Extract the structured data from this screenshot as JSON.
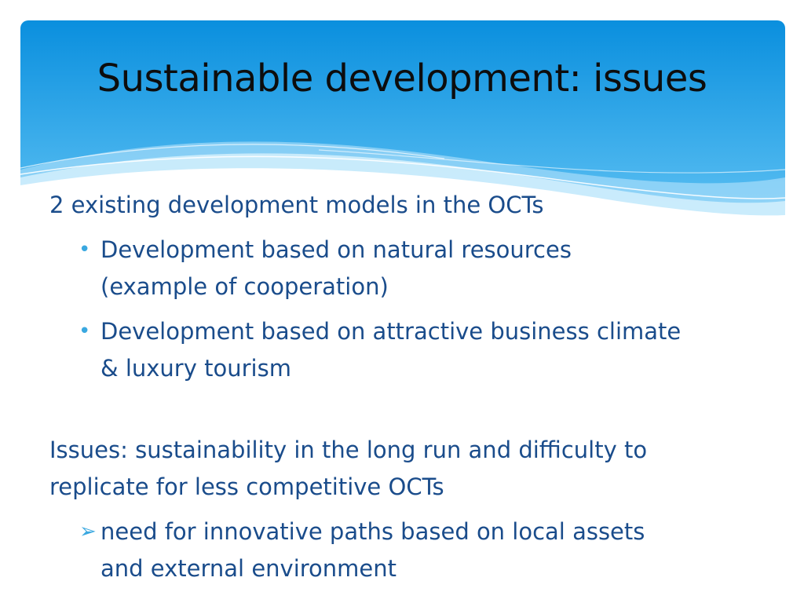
{
  "slide": {
    "title": "Sustainable development: issues",
    "intro": "2 existing development models in the OCTs",
    "bullets": [
      {
        "lines": [
          "Development based on natural resources",
          "(example of cooperation)"
        ]
      },
      {
        "lines": [
          "Development based on attractive business climate",
          "& luxury tourism"
        ]
      }
    ],
    "issues_lines": [
      "Issues: sustainability in the long run and difficulty to",
      "replicate for less competitive OCTs"
    ],
    "arrow_point": {
      "lines": [
        " need for innovative paths based on local assets",
        "and external environment"
      ]
    },
    "icons": {
      "bullet": "•",
      "arrow": "➢"
    },
    "colors": {
      "header_top": "#0a8fde",
      "header_bottom": "#5fc3f5",
      "text": "#1a4c8b",
      "bullet": "#3aa8e0"
    }
  }
}
